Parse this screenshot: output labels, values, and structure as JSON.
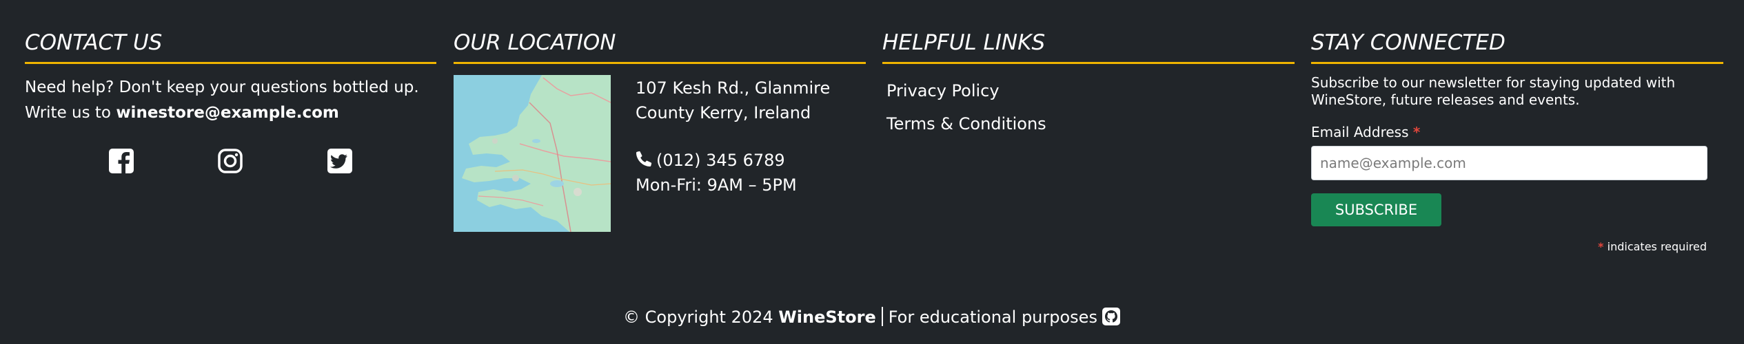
{
  "contact": {
    "heading": "CONTACT US",
    "line1": "Need help? Don't keep your questions bottled up.",
    "line2_prefix": "Write us to ",
    "email": "winestore@example.com",
    "socials": [
      {
        "icon": "facebook-icon"
      },
      {
        "icon": "instagram-icon"
      },
      {
        "icon": "twitter-icon"
      }
    ]
  },
  "location": {
    "heading": "OUR LOCATION",
    "address_line1": "107 Kesh Rd., Glanmire",
    "address_line2": "County Kerry, Ireland",
    "phone": "(012) 345 6789",
    "hours": "Mon-Fri: 9AM – 5PM"
  },
  "links": {
    "heading": "HELPFUL LINKS",
    "items": [
      {
        "label": "Privacy Policy"
      },
      {
        "label": "Terms & Conditions"
      }
    ]
  },
  "newsletter": {
    "heading": "STAY CONNECTED",
    "text": "Subscribe to our newsletter for staying updated with WineStore, future releases and events.",
    "email_label": "Email Address",
    "required_star": "*",
    "email_placeholder": "name@example.com",
    "email_value": "",
    "button_label": "SUBSCRIBE",
    "required_note": "indicates required"
  },
  "footer": {
    "copyright_prefix": "© Copyright 2024",
    "brand": "WineStore",
    "purpose": "For educational purposes"
  },
  "colors": {
    "background": "#212529",
    "accent": "#f0b400",
    "button": "#198754",
    "required": "#e0463c"
  }
}
